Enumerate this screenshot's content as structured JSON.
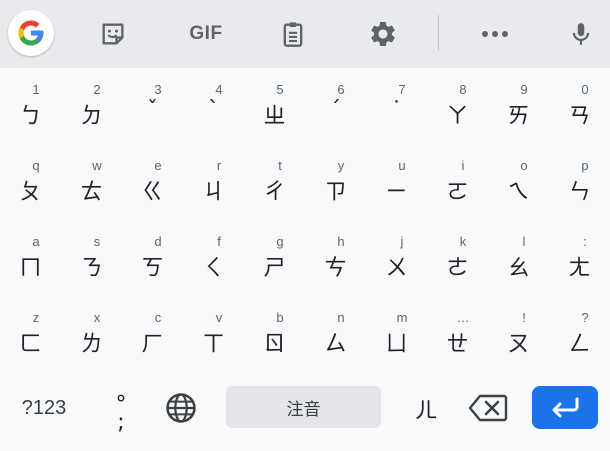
{
  "colors": {
    "toolbar_bg": "#e8eaed",
    "keyboard_bg": "#f8f9fa",
    "icon_gray": "#5f6368",
    "key_text": "#202124",
    "enter_blue": "#1a73e8",
    "google_blue": "#4285f4",
    "google_red": "#ea4335",
    "google_yellow": "#fbbc05",
    "google_green": "#34a853"
  },
  "toolbar": {
    "icons": [
      "google-g-icon",
      "sticker-icon",
      "gif-icon",
      "clipboard-icon",
      "gear-icon",
      "more-icon",
      "microphone-icon"
    ],
    "gif_label": "GIF"
  },
  "rows": [
    [
      {
        "hint": "1",
        "main": "ㄅ"
      },
      {
        "hint": "2",
        "main": "ㄉ"
      },
      {
        "hint": "3",
        "main": "ˇ"
      },
      {
        "hint": "4",
        "main": "ˋ"
      },
      {
        "hint": "5",
        "main": "ㄓ"
      },
      {
        "hint": "6",
        "main": "ˊ"
      },
      {
        "hint": "7",
        "main": "˙"
      },
      {
        "hint": "8",
        "main": "ㄚ"
      },
      {
        "hint": "9",
        "main": "ㄞ"
      },
      {
        "hint": "0",
        "main": "ㄢ"
      }
    ],
    [
      {
        "hint": "q",
        "main": "ㄆ"
      },
      {
        "hint": "w",
        "main": "ㄊ"
      },
      {
        "hint": "e",
        "main": "ㄍ"
      },
      {
        "hint": "r",
        "main": "ㄐ"
      },
      {
        "hint": "t",
        "main": "ㄔ"
      },
      {
        "hint": "y",
        "main": "ㄗ"
      },
      {
        "hint": "u",
        "main": "ㄧ"
      },
      {
        "hint": "i",
        "main": "ㄛ"
      },
      {
        "hint": "o",
        "main": "ㄟ"
      },
      {
        "hint": "p",
        "main": "ㄣ"
      }
    ],
    [
      {
        "hint": "a",
        "main": "ㄇ"
      },
      {
        "hint": "s",
        "main": "ㄋ"
      },
      {
        "hint": "d",
        "main": "ㄎ"
      },
      {
        "hint": "f",
        "main": "ㄑ"
      },
      {
        "hint": "g",
        "main": "ㄕ"
      },
      {
        "hint": "h",
        "main": "ㄘ"
      },
      {
        "hint": "j",
        "main": "ㄨ"
      },
      {
        "hint": "k",
        "main": "ㄜ"
      },
      {
        "hint": "l",
        "main": "ㄠ"
      },
      {
        "hint": ":",
        "main": "ㄤ"
      }
    ],
    [
      {
        "hint": "z",
        "main": "ㄈ"
      },
      {
        "hint": "x",
        "main": "ㄌ"
      },
      {
        "hint": "c",
        "main": "ㄏ"
      },
      {
        "hint": "v",
        "main": "ㄒ"
      },
      {
        "hint": "b",
        "main": "ㄖ"
      },
      {
        "hint": "n",
        "main": "ㄙ"
      },
      {
        "hint": "m",
        "main": "ㄩ"
      },
      {
        "hint": "…",
        "main": "ㄝ"
      },
      {
        "hint": "!",
        "main": "ㄡ"
      },
      {
        "hint": "?",
        "main": "ㄥ"
      }
    ]
  ],
  "bottom": {
    "symbols_label": "?123",
    "punct_top": "°",
    "punct_bottom": ";",
    "space_label": "注音",
    "er_label": "ㄦ",
    "icons": [
      "globe-icon",
      "backspace-icon",
      "enter-icon"
    ]
  }
}
